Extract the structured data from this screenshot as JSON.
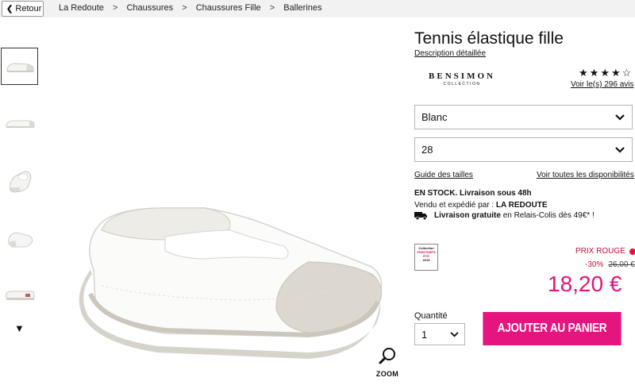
{
  "nav": {
    "back_label": "Retour",
    "breadcrumb": [
      "La Redoute",
      "Chaussures",
      "Chaussures Fille",
      "Ballerines"
    ],
    "separator": ">"
  },
  "gallery": {
    "thumbnail_count": 5,
    "selected_index": 0,
    "zoom_label": "ZOOM"
  },
  "product": {
    "title": "Tennis élastique fille",
    "description_link": "Description détaillée",
    "brand": {
      "name": "BENSIMON",
      "sub": "COLLECTION"
    },
    "rating": {
      "stars": 4,
      "max": 5
    },
    "reviews_link": "Voir le(s) 296 avis",
    "color_select": {
      "value": "Blanc"
    },
    "size_select": {
      "value": "28"
    },
    "size_guide_link": "Guide des tailles",
    "availability_link": "Voir toutes les disponibilités",
    "stock_text": "EN STOCK. Livraison sous 48h",
    "seller_prefix": "Vendu et expédié par :",
    "seller_name": "LA REDOUTE",
    "delivery_bold": "Livraison gratuite",
    "delivery_rest": "en Relais-Colis dès 49€* !"
  },
  "badge": {
    "line1": "Collection",
    "line2": "PRINTEMPS ÉTÉ",
    "line3": "2015"
  },
  "pricing": {
    "prix_rouge": "PRIX ROUGE",
    "discount": "-30%",
    "old_price": "26,00 €",
    "price": "18,20 €"
  },
  "cart": {
    "quantity_label": "Quantité",
    "quantity_value": "1",
    "add_button": "AJOUTER AU PANIER"
  },
  "colors": {
    "accent_pink": "#e5147f",
    "price_pink": "#e0147b",
    "prix_rouge_red": "#c5103a",
    "topbar_bg": "#f2f2f2"
  }
}
